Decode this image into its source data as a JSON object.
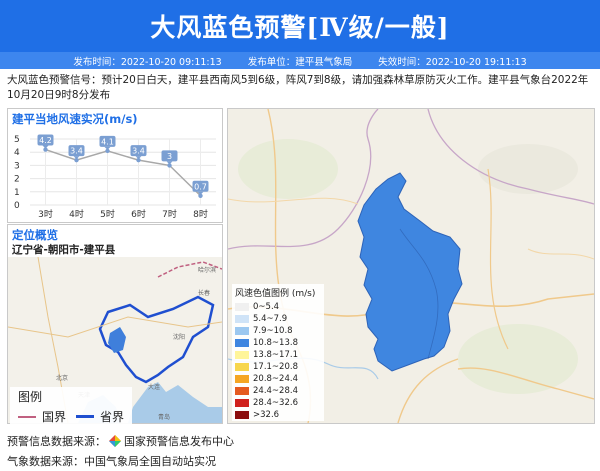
{
  "banner": {
    "title": "大风蓝色预警[Ⅳ级/一般]"
  },
  "infobar": {
    "issue_time": "发布时间：2022-10-20 09:11:13",
    "issuer": "发布单位：建平县气象局",
    "expire_time": "失效时间：2022-10-20 19:11:13"
  },
  "description": "大风蓝色预警信号：预计20日白天，建平县西南风5到6级，阵风7到8级，请加强森林草原防灭火工作。建平县气象台2022年10月20日9时8分发布",
  "wind_panel": {
    "title": "建平当地风速实况(m/s)"
  },
  "chart_data": {
    "type": "line",
    "title": "建平当地风速实况(m/s)",
    "categories": [
      "3时",
      "4时",
      "5时",
      "6时",
      "7时",
      "8时"
    ],
    "values": [
      4.2,
      3.4,
      4.1,
      3.4,
      3,
      0.7
    ],
    "ylim": [
      0,
      5
    ],
    "yticks": [
      "0",
      "1",
      "2",
      "3",
      "4",
      "5"
    ],
    "grid": true,
    "colors": {
      "line": "#a8a8a8",
      "label_bg": "#7b9fd2",
      "point": "#7b9fd2"
    }
  },
  "location_panel": {
    "title": "定位概览",
    "region": "辽宁省-朝阳市-建平县"
  },
  "location_map": {
    "labels": {
      "haerbin": "哈尔滨",
      "changchun": "长春",
      "shenyang": "沈阳",
      "beijing": "北京",
      "dalian": "大连",
      "tianjin": "天津",
      "qingdao": "青岛"
    }
  },
  "small_legend": {
    "title": "图例",
    "country": "国界",
    "province": "省界"
  },
  "map_legend": {
    "title": "风速色值图例 (m/s)",
    "items": [
      {
        "label": "0~5.4",
        "color": "#f0f0f0"
      },
      {
        "label": "5.4~7.9",
        "color": "#cfe3f7"
      },
      {
        "label": "7.9~10.8",
        "color": "#9cc8f0"
      },
      {
        "label": "10.8~13.8",
        "color": "#3f86e0"
      },
      {
        "label": "13.8~17.1",
        "color": "#fff59a"
      },
      {
        "label": "17.1~20.8",
        "color": "#f7d64c"
      },
      {
        "label": "20.8~24.4",
        "color": "#f5a623"
      },
      {
        "label": "24.4~28.4",
        "color": "#e55a1f"
      },
      {
        "label": "28.4~32.6",
        "color": "#d0211d"
      },
      {
        "label": ">32.6",
        "color": "#8b0e0e"
      }
    ]
  },
  "footer": {
    "warning_source_label": "预警信息数据来源：",
    "warning_source": "国家预警信息发布中心",
    "weather_source": "气象数据来源：中国气象局全国自动站实况"
  }
}
